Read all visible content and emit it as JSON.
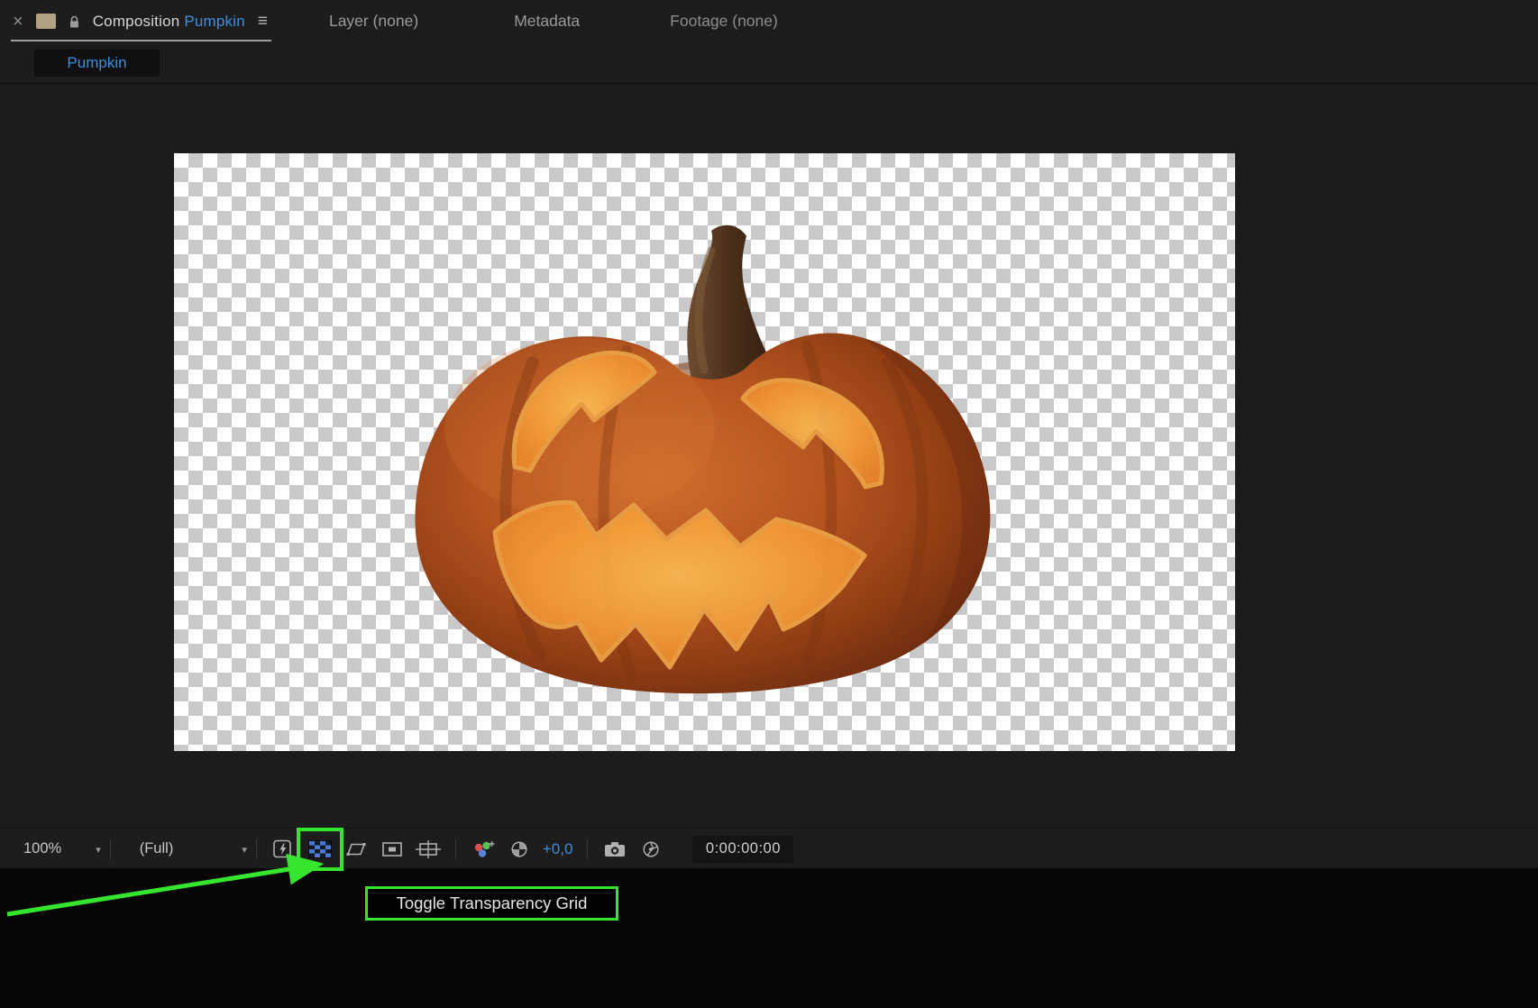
{
  "colors": {
    "accent_blue": "#3f8ede",
    "annotation_green": "#35e52e",
    "panel_bg": "#1d1d1d",
    "viewer_bg": "#1c1c1c",
    "checker_light": "#ffffff",
    "checker_dark": "#c9c9c9"
  },
  "tabbar": {
    "composition_tab": {
      "panel_label": "Composition",
      "comp_name": "Pumpkin"
    },
    "layer_tab": "Layer (none)",
    "metadata_tab": "Metadata",
    "footage_tab": "Footage (none)"
  },
  "comp_nav_tab": "Pumpkin",
  "toolbar": {
    "zoom_value": "100%",
    "resolution_value": "(Full)",
    "exposure_value": "+0,0",
    "timecode": "0:00:00:00"
  },
  "annotation": {
    "tooltip_label": "Toggle Transparency Grid"
  },
  "icons": {
    "close-icon": "×",
    "panel-menu-icon": "≡",
    "chevron-down-icon": "▾",
    "lock-icon": "padlock",
    "fast-preview-icon": "lightning-bolt",
    "transparency-grid-icon": "blue-checkerboard",
    "mask-visibility-icon": "bezier-shape",
    "grid-guides-icon": "square-in-square",
    "safe-margins-icon": "crosshair-square",
    "channel-icon": "rgb-dots",
    "reset-exposure-icon": "shutter-circle",
    "snapshot-icon": "camera",
    "show-snapshot-icon": "aperture"
  }
}
